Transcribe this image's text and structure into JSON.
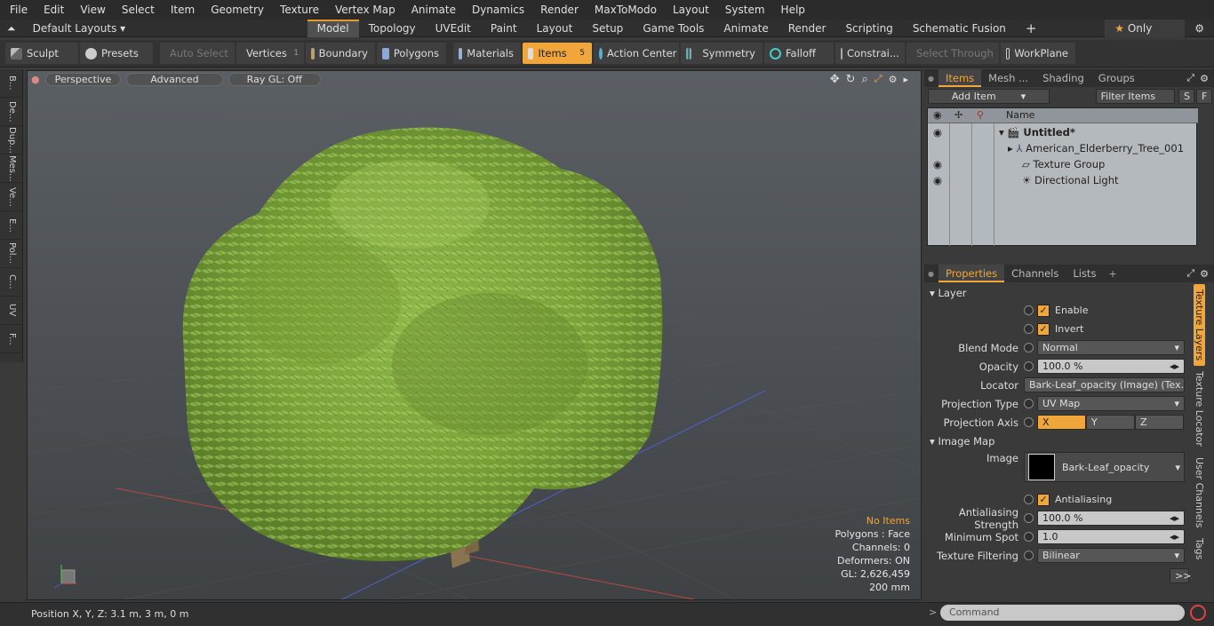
{
  "menu": [
    "File",
    "Edit",
    "View",
    "Select",
    "Item",
    "Geometry",
    "Texture",
    "Vertex Map",
    "Animate",
    "Dynamics",
    "Render",
    "MaxToModo",
    "Layout",
    "System",
    "Help"
  ],
  "layouts": {
    "selector": "Default Layouts",
    "tabs": [
      "Model",
      "Topology",
      "UVEdit",
      "Paint",
      "Layout",
      "Setup",
      "Game Tools",
      "Animate",
      "Render",
      "Scripting",
      "Schematic Fusion"
    ],
    "active": "Model",
    "only_label": "Only"
  },
  "toolbar": {
    "sculpt": "Sculpt",
    "presets": "Presets",
    "auto_select": "Auto Select",
    "vertices": "Vertices",
    "vertices_count": "1",
    "boundary": "Boundary",
    "polygons": "Polygons",
    "materials": "Materials",
    "items": "Items",
    "items_count": "5",
    "action_center": "Action Center",
    "symmetry": "Symmetry",
    "falloff": "Falloff",
    "constraints": "Constrai...",
    "select_through": "Select Through",
    "workplane": "WorkPlane"
  },
  "left_tabs": [
    "B...",
    "De...",
    "Dup...",
    "Mes...",
    "Ve...",
    "E...",
    "Pol...",
    "C...",
    "UV",
    "F..."
  ],
  "viewport": {
    "perspective": "Perspective",
    "advanced": "Advanced",
    "raygl": "Ray GL: Off",
    "stats": {
      "selection": "No Items",
      "polygons": "Polygons : Face",
      "channels": "Channels: 0",
      "deformers": "Deformers: ON",
      "gl": "GL: 2,626,459",
      "size": "200 mm"
    }
  },
  "status": "Position X, Y, Z:   3.1 m, 3 m, 0 m",
  "items_panel": {
    "tabs": [
      "Items",
      "Mesh ...",
      "Shading",
      "Groups"
    ],
    "add_item": "Add Item",
    "filter": "Filter Items",
    "s": "S",
    "f": "F",
    "col_name": "Name",
    "tree": [
      "Untitled*",
      "American_Elderberry_Tree_001",
      "Texture Group",
      "Directional Light"
    ]
  },
  "props": {
    "tabs": [
      "Properties",
      "Channels",
      "Lists"
    ],
    "layer": "Layer",
    "enable": "Enable",
    "invert": "Invert",
    "blend_mode_label": "Blend Mode",
    "blend_mode": "Normal",
    "opacity_label": "Opacity",
    "opacity": "100.0 %",
    "locator_label": "Locator",
    "locator": "Bark-Leaf_opacity (Image) (Tex...",
    "proj_type_label": "Projection Type",
    "proj_type": "UV Map",
    "proj_axis_label": "Projection Axis",
    "axis": [
      "X",
      "Y",
      "Z"
    ],
    "image_map": "Image Map",
    "image_label": "Image",
    "image_value": "Bark-Leaf_opacity",
    "antialiasing": "Antialiasing",
    "aa_strength_label": "Antialiasing Strength",
    "aa_strength": "100.0 %",
    "min_spot_label": "Minimum Spot",
    "min_spot": "1.0",
    "tex_filter_label": "Texture Filtering",
    "tex_filter": "Bilinear",
    "more": ">>",
    "vtabs": [
      "Texture Layers",
      "Texture Locator",
      "User Channels",
      "Tags"
    ]
  },
  "command": "Command"
}
